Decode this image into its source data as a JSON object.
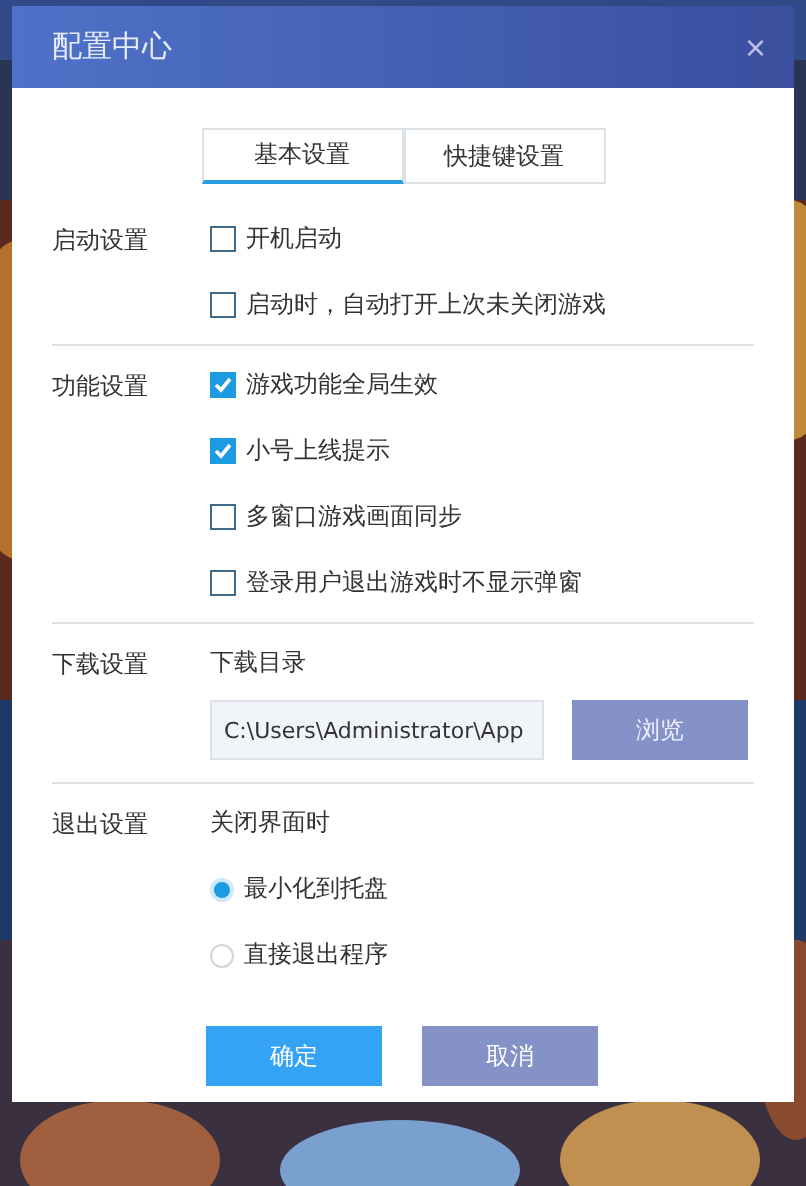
{
  "window": {
    "title": "配置中心",
    "close": "×"
  },
  "tabs": [
    {
      "label": "基本设置",
      "selected": true
    },
    {
      "label": "快捷键设置",
      "selected": false
    }
  ],
  "sections": [
    {
      "label": "启动设置",
      "kind": "checkboxes",
      "options": [
        {
          "label": "开机启动",
          "checked": false
        },
        {
          "label": "启动时，自动打开上次未关闭游戏",
          "checked": false
        }
      ]
    },
    {
      "label": "功能设置",
      "kind": "checkboxes",
      "options": [
        {
          "label": "游戏功能全局生效",
          "checked": true
        },
        {
          "label": "小号上线提示",
          "checked": true
        },
        {
          "label": "多窗口游戏画面同步",
          "checked": false
        },
        {
          "label": "登录用户退出游戏时不显示弹窗",
          "checked": false
        }
      ]
    },
    {
      "label": "下载设置",
      "kind": "folder",
      "caption": "下载目录",
      "path": "C:\\Users\\Administrator\\App",
      "button": "浏览"
    },
    {
      "label": "退出设置",
      "kind": "radios",
      "caption": "关闭界面时",
      "options": [
        {
          "label": "最小化到托盘",
          "selected": true
        },
        {
          "label": "直接退出程序",
          "selected": false
        }
      ]
    }
  ],
  "buttons": [
    {
      "label": "确定",
      "kind": "primary"
    },
    {
      "label": "取消",
      "kind": "secondary"
    }
  ]
}
